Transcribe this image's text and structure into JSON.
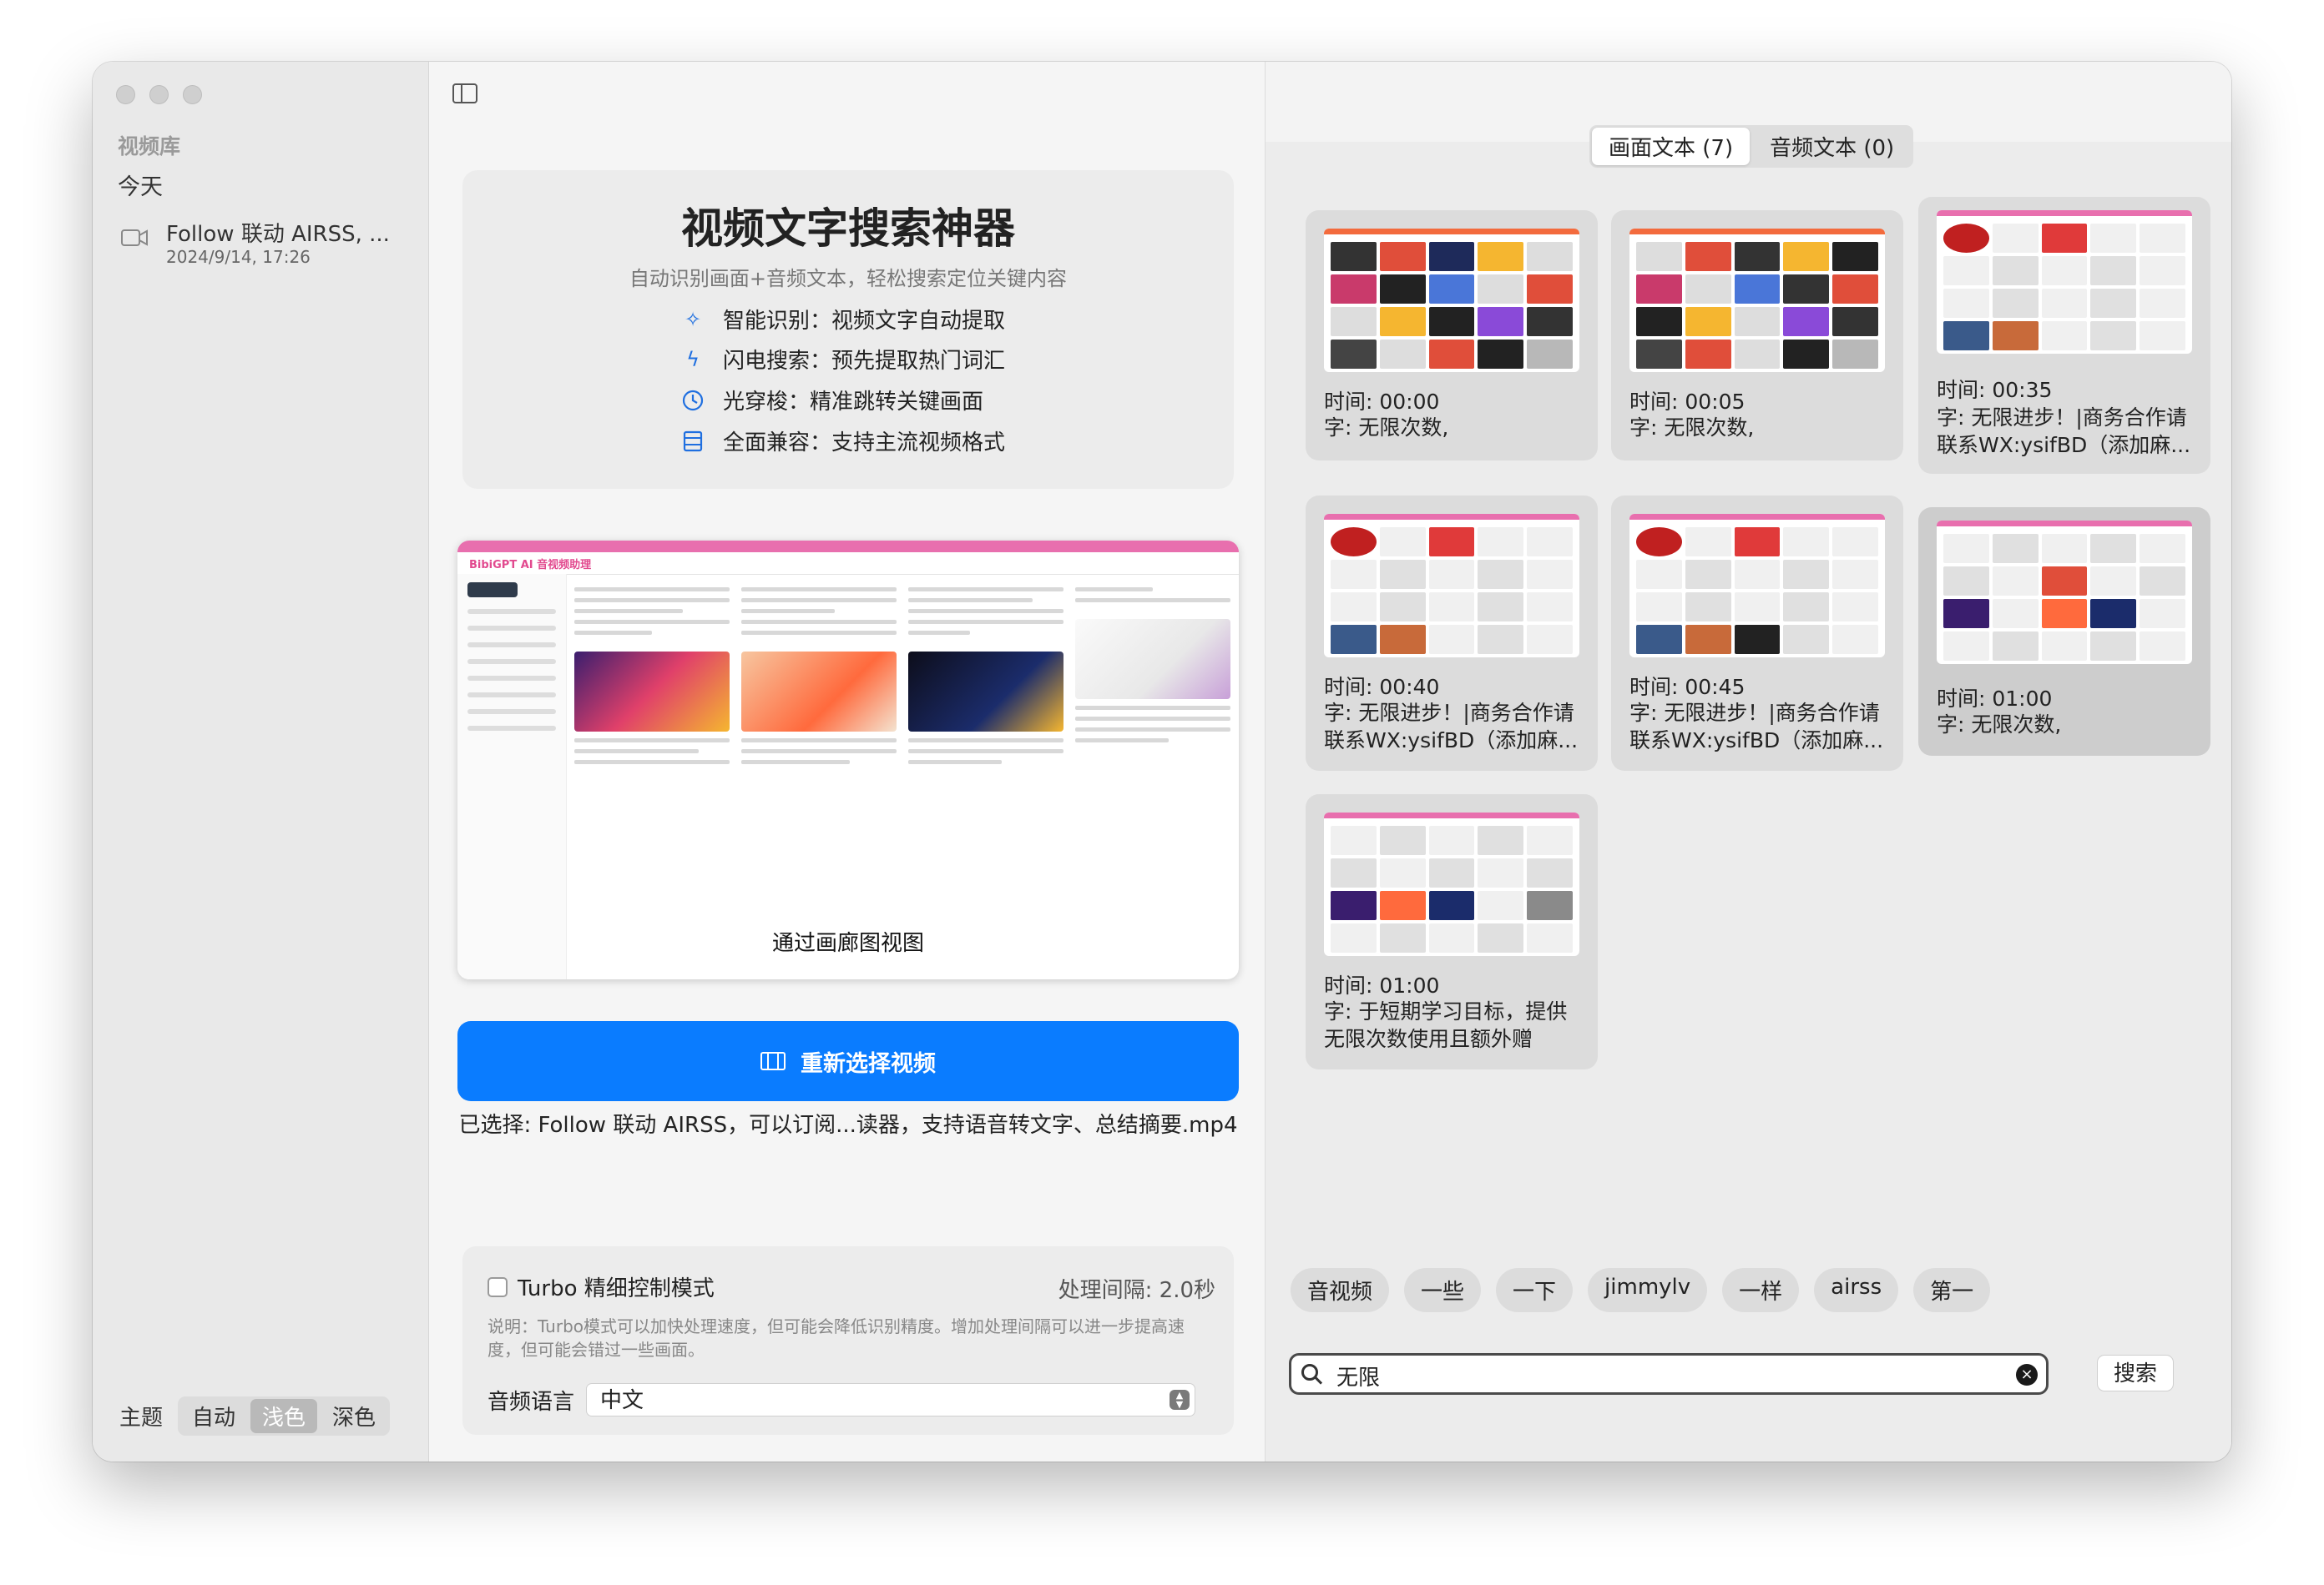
{
  "sidebar": {
    "section_title": "视频库",
    "group_label": "今天",
    "items": [
      {
        "title": "Follow 联动 AIRSS, ...",
        "date": "2024/9/14, 17:26"
      }
    ],
    "theme": {
      "label": "主题",
      "options": [
        "自动",
        "浅色",
        "深色"
      ],
      "active": "浅色"
    }
  },
  "intro": {
    "title": "视频文字搜索神器",
    "subtitle": "自动识别画面+音频文本，轻松搜索定位关键内容",
    "features": [
      {
        "icon": "sparkle-icon",
        "text": "智能识别：视频文字自动提取"
      },
      {
        "icon": "lightning-icon",
        "text": "闪电搜索：预先提取热门词汇"
      },
      {
        "icon": "clock-icon",
        "text": "光穿梭：精准跳转关键画面"
      },
      {
        "icon": "film-icon",
        "text": "全面兼容：支持主流视频格式"
      }
    ]
  },
  "preview": {
    "caption": "通过画廊图视图",
    "logo": "BibiGPT AI 音视频助理"
  },
  "actions": {
    "reselect_label": "重新选择视频",
    "selected_text": "已选择: Follow 联动 AIRSS，可以订阅...读器，支持语音转文字、总结摘要.mp4"
  },
  "settings": {
    "turbo_label": "Turbo 精细控制模式",
    "turbo_checked": false,
    "interval_label": "处理间隔: 2.0秒",
    "note": "说明：Turbo模式可以加快处理速度，但可能会降低识别精度。增加处理间隔可以进一步提高速度，但可能会错过一些画面。",
    "language_label": "音频语言",
    "language_value": "中文"
  },
  "results": {
    "tabs": [
      "画面文本 (7)",
      "音频文本 (0)"
    ],
    "active_tab": "画面文本 (7)",
    "cards": [
      {
        "time": "时间: 00:00",
        "text": "字: 无限次数,"
      },
      {
        "time": "时间: 00:05",
        "text": "字: 无限次数,"
      },
      {
        "time": "时间: 00:35",
        "text": "字: 无限进步！|商务合作请联系WX:ysifBD（添加麻..."
      },
      {
        "time": "时间: 00:40",
        "text": "字: 无限进步！|商务合作请联系WX:ysifBD（添加麻..."
      },
      {
        "time": "时间: 00:45",
        "text": "字: 无限进步！|商务合作请联系WX:ysifBD（添加麻..."
      },
      {
        "time": "时间: 01:00",
        "text": "字: 无限次数,"
      },
      {
        "time": "时间: 01:00",
        "text": "字: 于短期学习目标，提供无限次数使用且额外赠"
      }
    ],
    "tags": [
      "音视频",
      "一些",
      "一下",
      "jimmylv",
      "一样",
      "airss",
      "第一"
    ],
    "search_value": "无限",
    "search_button": "搜索"
  },
  "colors": {
    "accent": "#0a7cff",
    "icon_blue": "#1f6fe0",
    "preview_pink": "#e86fae"
  }
}
